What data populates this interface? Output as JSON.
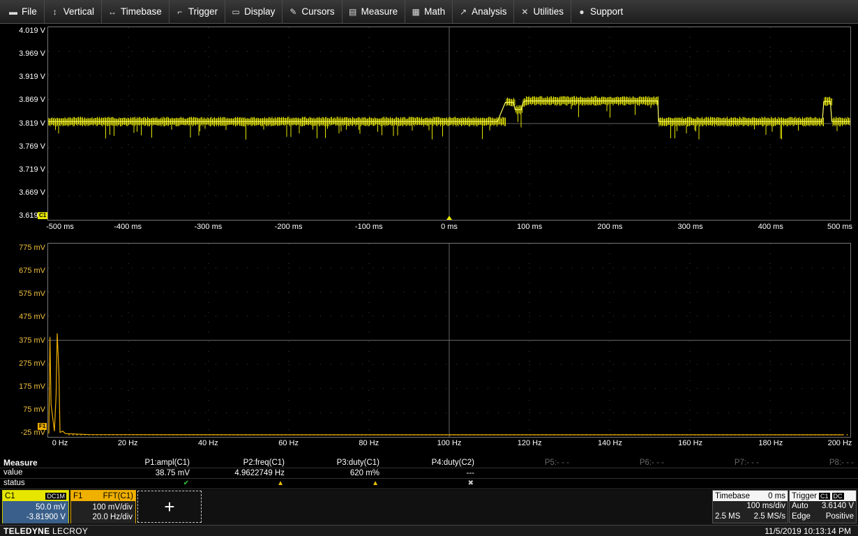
{
  "menu": [
    {
      "label": "File",
      "icon": "file-icon"
    },
    {
      "label": "Vertical",
      "icon": "vertical-arrows-icon"
    },
    {
      "label": "Timebase",
      "icon": "horizontal-arrows-icon"
    },
    {
      "label": "Trigger",
      "icon": "trigger-icon"
    },
    {
      "label": "Display",
      "icon": "display-icon"
    },
    {
      "label": "Cursors",
      "icon": "cursor-icon"
    },
    {
      "label": "Measure",
      "icon": "measure-icon"
    },
    {
      "label": "Math",
      "icon": "calculator-icon"
    },
    {
      "label": "Analysis",
      "icon": "chart-icon"
    },
    {
      "label": "Utilities",
      "icon": "tools-icon"
    },
    {
      "label": "Support",
      "icon": "info-icon"
    }
  ],
  "colors": {
    "trace_c1": "#e6e600",
    "trace_f1": "#f0b000",
    "grid": "#555555"
  },
  "chart_data": [
    {
      "type": "line",
      "series": [
        {
          "name": "C1",
          "x": [
            -500,
            -400,
            -300,
            -200,
            -100,
            0,
            60,
            70,
            80,
            82,
            90,
            92,
            95,
            100,
            200,
            260,
            261,
            300,
            400,
            465,
            467,
            475,
            477,
            500
          ],
          "values": [
            3.823,
            3.823,
            3.823,
            3.823,
            3.823,
            3.823,
            3.823,
            3.863,
            3.863,
            3.848,
            3.848,
            3.863,
            3.866,
            3.866,
            3.866,
            3.866,
            3.823,
            3.823,
            3.823,
            3.823,
            3.865,
            3.865,
            3.823,
            3.823
          ]
        }
      ],
      "y_tick_labels": [
        "4.019 V",
        "3.969 V",
        "3.919 V",
        "3.869 V",
        "3.819 V",
        "3.769 V",
        "3.719 V",
        "3.669 V",
        "3.619 V"
      ],
      "x_tick_labels": [
        "-500 ms",
        "-400 ms",
        "-300 ms",
        "-200 ms",
        "-100 ms",
        "0 ms",
        "100 ms",
        "200 ms",
        "300 ms",
        "400 ms",
        "500 ms"
      ],
      "xlim": [
        -500,
        500
      ],
      "ylim": [
        3.619,
        4.019
      ],
      "xlabel": "",
      "ylabel": "",
      "grid": true
    },
    {
      "type": "line",
      "series": [
        {
          "name": "F1",
          "x": [
            0,
            0.2,
            0.4,
            1.0,
            1.3,
            1.5,
            1.8,
            2.0,
            2.5,
            4,
            10,
            50,
            100,
            150,
            200
          ],
          "values": [
            -20,
            380,
            100,
            -10,
            140,
            395,
            240,
            -15,
            -10,
            -20,
            -24,
            -25,
            -25,
            -25,
            -25
          ]
        }
      ],
      "y_tick_labels": [
        "775 mV",
        "675 mV",
        "575 mV",
        "475 mV",
        "375 mV",
        "275 mV",
        "175 mV",
        "75 mV",
        "-25 mV"
      ],
      "x_tick_labels": [
        "0 Hz",
        "20 Hz",
        "40 Hz",
        "60 Hz",
        "80 Hz",
        "100 Hz",
        "120 Hz",
        "140 Hz",
        "160 Hz",
        "180 Hz",
        "200 Hz"
      ],
      "xlim": [
        0,
        200
      ],
      "ylim": [
        -25,
        775
      ],
      "xlabel": "",
      "ylabel": "",
      "grid": true
    }
  ],
  "markers": {
    "c1": "C1",
    "f1": "F1"
  },
  "measure": {
    "title": "Measure",
    "row_value": "value",
    "row_status": "status",
    "params": [
      {
        "name": "P1:ampl(C1)",
        "value": "38.75 mV",
        "status": "ok"
      },
      {
        "name": "P2:freq(C1)",
        "value": "4.9622749 Hz",
        "status": "warn"
      },
      {
        "name": "P3:duty(C1)",
        "value": "620 m%",
        "status": "warn"
      },
      {
        "name": "P4:duty(C2)",
        "value": "---",
        "status": "invalid"
      },
      {
        "name": "P5:- - -",
        "value": "",
        "status": ""
      },
      {
        "name": "P6:- - -",
        "value": "",
        "status": ""
      },
      {
        "name": "P7:- - -",
        "value": "",
        "status": ""
      },
      {
        "name": "P8:- - -",
        "value": "",
        "status": ""
      }
    ]
  },
  "c1_desc": {
    "label": "C1",
    "coupling": "DC1M",
    "vdiv": "50.0 mV",
    "offset": "-3.81900 V"
  },
  "f1_desc": {
    "label": "F1",
    "func": "FFT(C1)",
    "vdiv": "100 mV/div",
    "hdiv": "20.0 Hz/div"
  },
  "add_label": "+",
  "timebase": {
    "label": "Timebase",
    "delay": "0 ms",
    "tdiv": "100 ms/div",
    "samples": "2.5 MS",
    "rate": "2.5 MS/s"
  },
  "trigger": {
    "label": "Trigger",
    "source": "C1",
    "coupling": "DC",
    "mode": "Auto",
    "level": "3.6140 V",
    "type": "Edge",
    "slope": "Positive"
  },
  "status": {
    "brand_bold": "TELEDYNE",
    "brand_rest": " LECROY",
    "datetime": "11/5/2019 10:13:14 PM"
  }
}
